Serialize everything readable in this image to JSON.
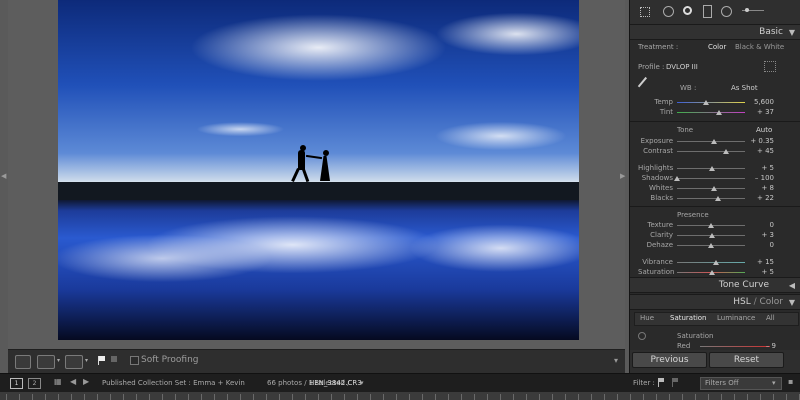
{
  "tools": [
    "crop-overlay-icon",
    "spot-removal-icon",
    "red-eye-icon",
    "graduated-filter-icon",
    "radial-filter-icon",
    "brush-icon"
  ],
  "basic": {
    "title": "Basic",
    "treatment_label": "Treatment :",
    "treatment_color": "Color",
    "treatment_bw": "Black & White",
    "profile_label": "Profile :",
    "profile_value": "DVLOP III",
    "wb_label": "WB :",
    "wb_value": "As Shot",
    "tone_label": "Tone",
    "tone_auto": "Auto",
    "presence_label": "Presence",
    "wb_sliders": [
      {
        "label": "Temp",
        "value": "5,600",
        "pos": 0.43
      },
      {
        "label": "Tint",
        "value": "+ 37",
        "pos": 0.62
      }
    ],
    "tone_sliders": [
      {
        "label": "Exposure",
        "value": "+ 0.35",
        "pos": 0.54
      },
      {
        "label": "Contrast",
        "value": "+ 45",
        "pos": 0.72
      },
      {
        "label": "Highlights",
        "value": "+ 5",
        "pos": 0.52
      },
      {
        "label": "Shadows",
        "value": "– 100",
        "pos": 0.0
      },
      {
        "label": "Whites",
        "value": "+ 8",
        "pos": 0.54
      },
      {
        "label": "Blacks",
        "value": "+ 22",
        "pos": 0.61
      }
    ],
    "presence_sliders": [
      {
        "label": "Texture",
        "value": "0",
        "pos": 0.5
      },
      {
        "label": "Clarity",
        "value": "+ 3",
        "pos": 0.52
      },
      {
        "label": "Dehaze",
        "value": "0",
        "pos": 0.5
      },
      {
        "label": "Vibrance",
        "value": "+ 15",
        "pos": 0.57
      },
      {
        "label": "Saturation",
        "value": "+ 5",
        "pos": 0.52
      }
    ]
  },
  "tone_curve": {
    "title": "Tone Curve"
  },
  "hsl": {
    "title_hsl": "HSL",
    "title_sep": " / ",
    "title_color": "Color",
    "tabs": [
      "Hue",
      "Saturation",
      "Luminance",
      "All"
    ],
    "sub_title": "Saturation",
    "red_label": "Red",
    "red_value": "– 9"
  },
  "buttons": {
    "previous": "Previous",
    "reset": "Reset"
  },
  "toolbar": {
    "soft_proofing": "Soft Proofing"
  },
  "filmbar": {
    "screen1": "1",
    "screen2": "2",
    "source": "Published Collection Set : Emma + Kevin",
    "count": "66 photos / 1 selected /",
    "filename": "HEN_3842.CR3",
    "filter_label": "Filter :",
    "filter_value": "Filters Off"
  },
  "colors": {
    "panel_bg": "#2a2a2a",
    "center_bg": "#5d5d5d",
    "accent": "#d0d0d0"
  }
}
